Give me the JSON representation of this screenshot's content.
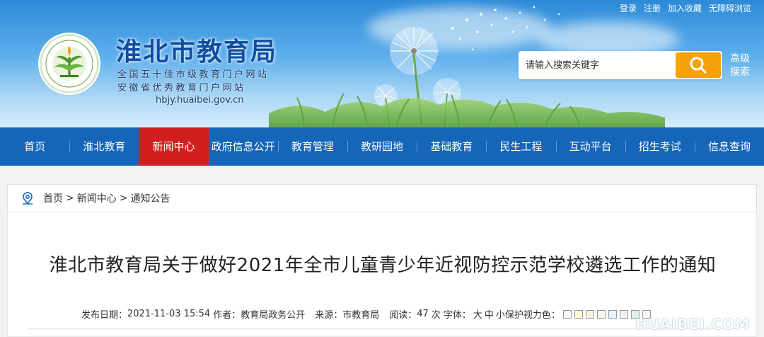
{
  "top_links": [
    "登录",
    "注册",
    "加入收藏",
    "无障碍浏览"
  ],
  "header": {
    "site_title": "淮北市教育局",
    "slogan_1": "全国五十佳市级教育门户网站",
    "slogan_2": "安徽省优秀教育门户网站",
    "domain": "hbjy.huaibei.gov.cn"
  },
  "search": {
    "placeholder": "请输入搜索关键字",
    "advanced_label": "高级搜索"
  },
  "nav": {
    "items": [
      {
        "label": "首页"
      },
      {
        "label": "淮北教育"
      },
      {
        "label": "新闻中心",
        "active": true
      },
      {
        "label": "政府信息公开"
      },
      {
        "label": "教育管理"
      },
      {
        "label": "教研园地"
      },
      {
        "label": "基础教育"
      },
      {
        "label": "民生工程"
      },
      {
        "label": "互动平台"
      },
      {
        "label": "招生考试"
      },
      {
        "label": "信息查询"
      }
    ]
  },
  "breadcrumb": [
    "首页",
    "新闻中心",
    "通知公告"
  ],
  "breadcrumb_sep": ">",
  "article": {
    "title": "淮北市教育局关于做好2021年全市儿童青少年近视防控示范学校遴选工作的通知",
    "publish_label": "发布日期：",
    "publish_date": "2021-11-03 15:54",
    "author_label": "作者：",
    "author": "教育局政务公开",
    "source_label": "来源：",
    "source": "市教育局",
    "reads_label": "阅读：",
    "reads": "47",
    "reads_unit": "次",
    "font_label": "字体：",
    "font_sizes": [
      "大",
      "中",
      "小"
    ],
    "eye_color_label": "保护视力色：",
    "eye_colors": [
      "#fafafa",
      "#fff6d8",
      "#fff0e6",
      "#f2ffe6",
      "#e8f4ff",
      "#f0f0f0",
      "#e2f0e2",
      "#f8f8f8"
    ]
  },
  "watermark": {
    "text": "HUAIBEI.COM"
  },
  "colors": {
    "nav_bg": "#1565b8",
    "nav_active": "#d11f1f",
    "search_button": "#f5a20a",
    "title_blue": "#0f4ea3"
  }
}
